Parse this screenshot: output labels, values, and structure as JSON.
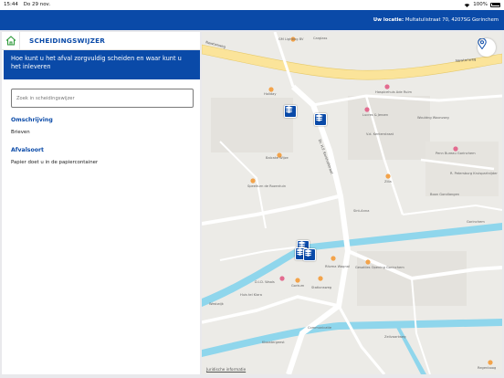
{
  "status_bar": {
    "time": "15:44",
    "date": "Do 29 nov.",
    "battery": "100%"
  },
  "header": {
    "location_label": "Uw locatie:",
    "location_value": "Multatulistraat 70, 4207SG Gorinchem"
  },
  "panel": {
    "title": "SCHEIDINGSWIJZER",
    "banner": "Hoe kunt u het afval zorgvuldig scheiden en waar kunt u het inleveren",
    "search_placeholder": "Zoek in scheidingswijzer",
    "description_label": "Omschrijving",
    "description_value": "Brieven",
    "waste_type_label": "Afvalsoort",
    "waste_type_value": "Papier doet u in de papiercontainer"
  },
  "map": {
    "legal": "Juridische informatie",
    "labels": {
      "newtonweg_1": "Newtonweg",
      "newtonweg_2": "Newtonweg",
      "lighting": "GM Lighting BV",
      "carglass": "Carglass",
      "holiday": "Holiday",
      "hospital": "Hospicehuis Ade Ruim",
      "jeroen": "Lucres & Jeroen",
      "wouldng": "Wouldng Woonzorg",
      "koster": "Koster Bureau Gorinchem",
      "vdk": "V.d. Kenterstraat",
      "kelvin": "Kelvinweg",
      "balcake": "Balcake Wijze",
      "speelturn": "Speelturn de Rozentuin",
      "penn": "Penn Bureau Gorinchem",
      "petersburg": "R. Petersburg Kruispartnijder",
      "zilla": "Zilla",
      "boon": "Boon Gondlangen",
      "ruyter": "De Ruyter",
      "sintanna": "Sint-Anna",
      "gorinchem": "Gorinchem",
      "gesatiles": "Gesatiles Opening Gorinchem",
      "ritzma": "Ritzma Wagnal",
      "waals": "D.I.D. Waals",
      "gorkum": "Gorkum",
      "jmebem": "Vanhyalsbijer",
      "kraai": "Stationsweg",
      "westwijk": "Westwijk",
      "communicatie": "Communicatie",
      "huis": "Huis tel Klara",
      "klos": "Kloostergeest",
      "zeilvaart": "Zeilvaartweg",
      "regenboog": "Regenboog",
      "dr_kerkhof": "Dr. H.F. Kerkhofstraat"
    }
  },
  "colors": {
    "brand": "#0a4aa8",
    "water": "#8fd6ec",
    "road": "#ffffff",
    "highway": "#fbe49a",
    "poi_orange": "#f3a34a",
    "poi_pink": "#e36b8f"
  },
  "icons": {
    "home": "home-icon",
    "location": "location-pin-icon",
    "marker": "container-marker-icon"
  }
}
